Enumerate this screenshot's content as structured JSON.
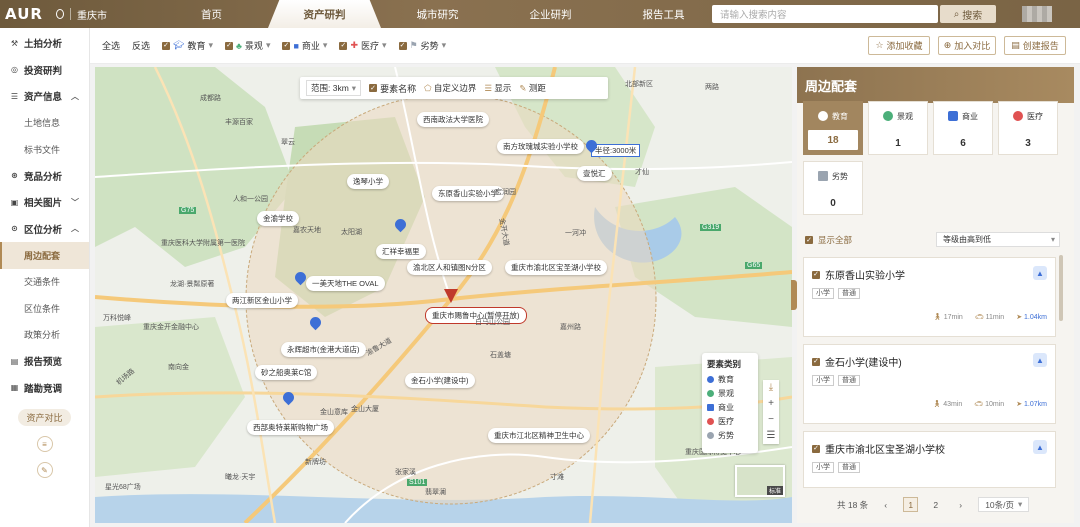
{
  "header": {
    "logo": "AUR",
    "city": "重庆市",
    "nav": [
      "首页",
      "资产研判",
      "城市研究",
      "企业研判",
      "报告工具"
    ],
    "active_nav": 1,
    "search_placeholder": "请输入搜索内容",
    "search_button": "搜索"
  },
  "sidebar": {
    "items": [
      {
        "label": "土拍分析",
        "icon": "gavel-icon"
      },
      {
        "label": "投资研判",
        "icon": "target-icon"
      },
      {
        "label": "资产信息",
        "icon": "list-icon",
        "expanded": true
      },
      {
        "label": "土地信息",
        "sub": true
      },
      {
        "label": "标书文件",
        "sub": true
      },
      {
        "label": "竞品分析",
        "icon": "compass-icon"
      },
      {
        "label": "相关图片",
        "icon": "image-icon",
        "expanded": false
      },
      {
        "label": "区位分析",
        "icon": "location-icon",
        "expanded": true
      },
      {
        "label": "周边配套",
        "sub": true,
        "active": true
      },
      {
        "label": "交通条件",
        "sub": true
      },
      {
        "label": "区位条件",
        "sub": true
      },
      {
        "label": "政策分析",
        "sub": true
      },
      {
        "label": "报告预览",
        "icon": "report-icon"
      },
      {
        "label": "踏勘竞调",
        "icon": "survey-icon"
      }
    ],
    "compare_button": "资产对比"
  },
  "filters": {
    "select_all": "全选",
    "invert": "反选",
    "categories": [
      "教育",
      "景观",
      "商业",
      "医疗",
      "劣势"
    ],
    "actions": [
      "添加收藏",
      "加入对比",
      "创建报告"
    ]
  },
  "map": {
    "toolbar": {
      "range_label": "范围: 3km",
      "name_toggle": "要素名称",
      "custom_boundary": "自定义边界",
      "display": "显示",
      "measure": "测距"
    },
    "radius_tag": "半径:3000米",
    "center_label": "重庆市赐鲁中心(暂停开放)",
    "poi_labels": [
      "西南政法大学医院",
      "南方玫瑰城实验小学校",
      "壹悦汇",
      "逸琴小学",
      "东原香山实验小学",
      "金渝学校",
      "汇祥幸福里",
      "渝北区人和镇图N分区",
      "重庆市渝北区宝圣湖小学校",
      "一美天地THE OVAL",
      "两江新区金山小学",
      "永辉超市(金港大道店)",
      "砂之船奥莱C馆",
      "金石小学(建设中)",
      "西部奥特莱斯购物广场",
      "重庆市江北区精神卫生中心"
    ],
    "places": [
      "成都路",
      "丰源百家",
      "翠云",
      "人和一公园",
      "嘉农天地",
      "太阳湖",
      "重庆医科大学附属第一医院",
      "龙湖·景粼原著",
      "万科悦峰",
      "重庆金开金融中心",
      "南向金",
      "金山大厦",
      "白马山公园",
      "宏润园",
      "一河冲",
      "石盖塘",
      "张家溪",
      "寸滩",
      "重庆国际博览中心",
      "两路",
      "北部新区",
      "嘉州路",
      "才仙",
      "星光68广场",
      "曦龙·天宇",
      "翡翠澜",
      "新牌坊",
      "金山意库"
    ],
    "roads": [
      "G75",
      "G319",
      "S101",
      "G65",
      "金开大道",
      "机场路",
      "渝鲁大道"
    ],
    "legend": {
      "title": "要素类别",
      "items": [
        "教育",
        "景观",
        "商业",
        "医疗",
        "劣势"
      ]
    },
    "minimap_label": "标准"
  },
  "panel": {
    "title": "周边配套",
    "categories": [
      {
        "label": "教育",
        "count": "18",
        "color": "#ffffff"
      },
      {
        "label": "景观",
        "count": "1",
        "color": "#4caf7a"
      },
      {
        "label": "商业",
        "count": "6",
        "color": "#3d6fd6"
      },
      {
        "label": "医疗",
        "count": "3",
        "color": "#e05252"
      },
      {
        "label": "劣势",
        "count": "0",
        "color": "#9aa4b0"
      }
    ],
    "show_all": "显示全部",
    "sort_value": "等级由高到低",
    "cards": [
      {
        "title": "东原香山实验小学",
        "tags": [
          "小学",
          "普通"
        ],
        "walk": "17min",
        "drive": "11min",
        "distance": "1.04km"
      },
      {
        "title": "金石小学(建设中)",
        "tags": [
          "小学",
          "普通"
        ],
        "walk": "43min",
        "drive": "10min",
        "distance": "1.07km"
      },
      {
        "title": "重庆市渝北区宝圣湖小学校",
        "tags": [
          "小学",
          "普通"
        ],
        "walk": "",
        "drive": "",
        "distance": ""
      }
    ],
    "pager": {
      "total": "共 18 条",
      "pages": [
        "1",
        "2"
      ],
      "page_size": "10条/页"
    }
  },
  "colors": {
    "brand": "#8a6a3f",
    "header": "#7a6445",
    "accent_blue": "#3d6fd6",
    "center_red": "#c0392b"
  }
}
